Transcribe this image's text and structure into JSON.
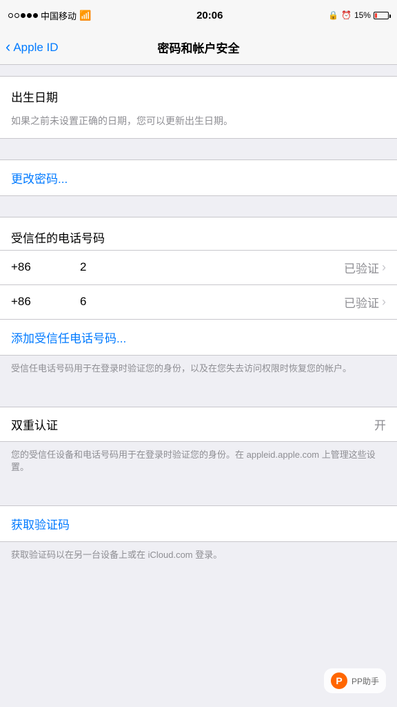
{
  "statusBar": {
    "carrier": "中国移动",
    "time": "20:06",
    "battery": "15%",
    "batteryPercent": 15
  },
  "navBar": {
    "backLabel": "Apple ID",
    "title": "密码和帐户安全"
  },
  "sections": {
    "birthdate": {
      "header": "出生日期",
      "description": "如果之前未设置正确的日期，您可以更新出生日期。"
    },
    "changePassword": {
      "label": "更改密码..."
    },
    "trustedPhone": {
      "header": "受信任的电话号码",
      "numbers": [
        {
          "prefix": "+86",
          "partial": "2",
          "status": "已验证"
        },
        {
          "prefix": "+86",
          "partial": "6",
          "status": "已验证"
        }
      ],
      "addLabel": "添加受信任电话号码...",
      "footerText": "受信任电话号码用于在登录时验证您的身份，以及在您失去访问权限时恢复您的帐户。"
    },
    "twoFactor": {
      "label": "双重认证",
      "status": "开",
      "description": "您的受信任设备和电话号码用于在登录时验证您的身份。在 appleid.apple.com 上管理这些设置。"
    },
    "verificationCode": {
      "label": "获取验证码",
      "description": "获取验证码以在另一台设备上或在 iCloud.com 登录。"
    }
  },
  "watermark": {
    "text": "PP助手"
  }
}
